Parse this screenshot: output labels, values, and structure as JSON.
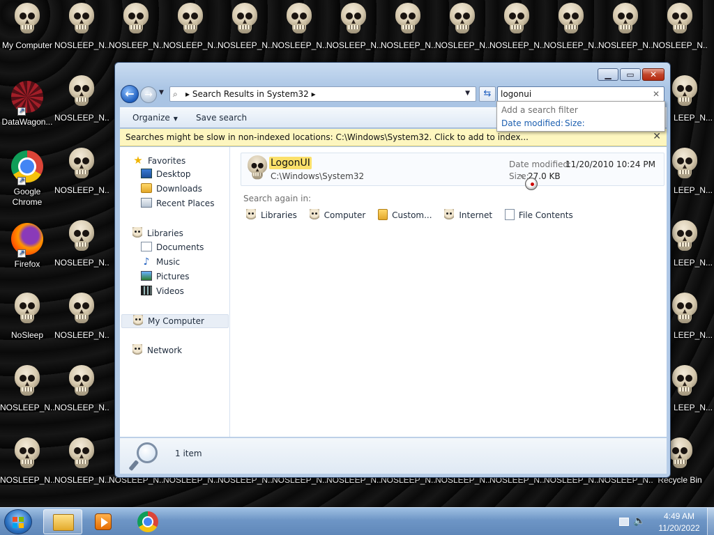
{
  "desktop": {
    "icons": [
      {
        "label": "My Computer",
        "kind": "skull"
      },
      {
        "label": "NOSLEEP_N...",
        "kind": "skull"
      },
      {
        "label": "DataWagon...",
        "kind": "datawagon"
      },
      {
        "label": "Google Chrome",
        "kind": "chrome"
      },
      {
        "label": "Firefox",
        "kind": "firefox"
      },
      {
        "label": "NoSleep",
        "kind": "skull"
      },
      {
        "label": "NOSLEEP_N...",
        "kind": "skull"
      },
      {
        "label": "NOSLEEP_N...",
        "kind": "skull"
      },
      {
        "label": "Recycle Bin",
        "kind": "recycle"
      }
    ],
    "repeated_label": "NOSLEEP_N...",
    "partial_label": "LEEP_N...",
    "recycle_label": "Recycle Bin"
  },
  "window": {
    "address": {
      "text": "Search Results in System32"
    },
    "search": {
      "value": "logonui"
    },
    "filter_popup": {
      "heading": "Add a search filter",
      "filters": [
        "Date modified:",
        "Size:"
      ]
    },
    "toolbar": {
      "organize": "Organize",
      "save_search": "Save search"
    },
    "info_bar": {
      "text": "Searches might be slow in non-indexed locations: C:\\Windows\\System32. Click to add to index..."
    },
    "nav": {
      "favorites": "Favorites",
      "desktop": "Desktop",
      "downloads": "Downloads",
      "recent": "Recent Places",
      "libraries": "Libraries",
      "documents": "Documents",
      "music": "Music",
      "pictures": "Pictures",
      "videos": "Videos",
      "my_computer": "My Computer",
      "network": "Network"
    },
    "result": {
      "name": "LogonUI",
      "path": "C:\\Windows\\System32",
      "date_label": "Date modified:",
      "date_value": "11/20/2010 10:24 PM",
      "size_label": "Size:",
      "size_value": "27.0 KB"
    },
    "search_again": {
      "label": "Search again in:",
      "items": [
        "Libraries",
        "Computer",
        "Custom...",
        "Internet",
        "File Contents"
      ]
    },
    "details": {
      "count": "1 item"
    }
  },
  "taskbar": {
    "time": "4:49 AM",
    "date": "11/20/2022"
  }
}
